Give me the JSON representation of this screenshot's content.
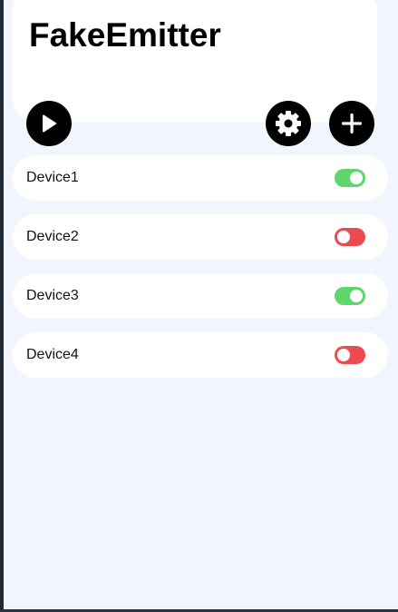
{
  "app": {
    "title": "FakeEmitter"
  },
  "toolbar": {
    "play_icon": "play-icon",
    "settings_icon": "gear-icon",
    "add_icon": "plus-icon"
  },
  "devices": [
    {
      "label": "Device1",
      "enabled": true
    },
    {
      "label": "Device2",
      "enabled": false
    },
    {
      "label": "Device3",
      "enabled": true
    },
    {
      "label": "Device4",
      "enabled": false
    }
  ],
  "colors": {
    "background": "#f1f5fe",
    "card": "#ffffff",
    "toggle_on": "#5fd56e",
    "toggle_off": "#ec4a4f",
    "button": "#000000"
  }
}
